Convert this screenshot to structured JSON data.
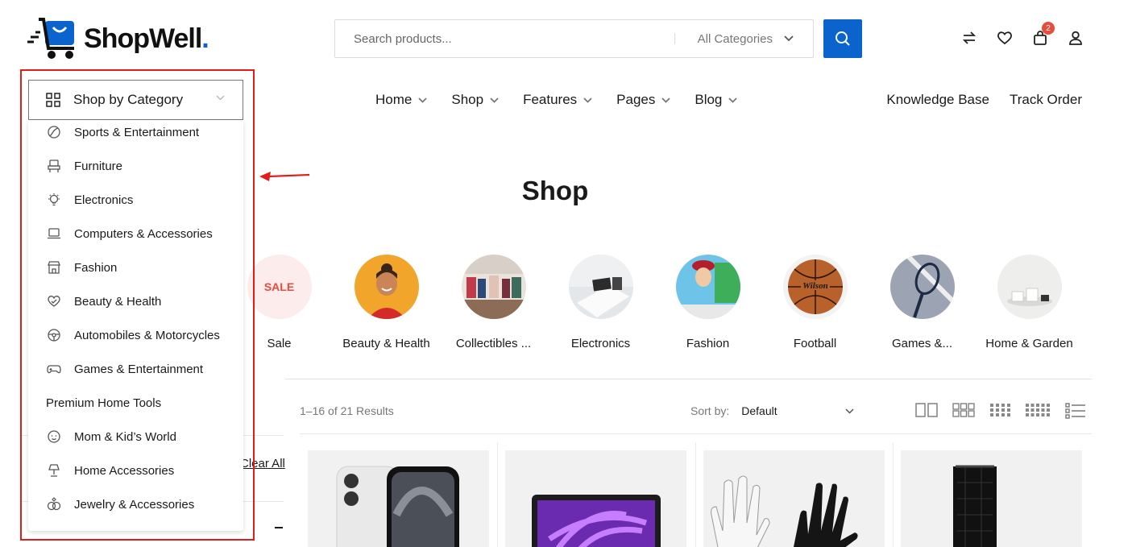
{
  "brand": {
    "name": "ShopWell",
    "dot": ".",
    "accent": "#0b63ce"
  },
  "search": {
    "placeholder": "Search products...",
    "category": "All Categories"
  },
  "header": {
    "cart_count": "2"
  },
  "nav": {
    "items": [
      {
        "label": "Home"
      },
      {
        "label": "Shop"
      },
      {
        "label": "Features"
      },
      {
        "label": "Pages"
      },
      {
        "label": "Blog"
      }
    ],
    "right": [
      {
        "label": "Knowledge Base"
      },
      {
        "label": "Track Order"
      }
    ]
  },
  "category_menu": {
    "toggle_label": "Shop by Category",
    "items": [
      {
        "label": "Sports & Entertainment",
        "icon": "ball-icon"
      },
      {
        "label": "Furniture",
        "icon": "chair-icon"
      },
      {
        "label": "Electronics",
        "icon": "bulb-icon"
      },
      {
        "label": "Computers & Accessories",
        "icon": "laptop-icon"
      },
      {
        "label": "Fashion",
        "icon": "store-icon"
      },
      {
        "label": "Beauty & Health",
        "icon": "heart-icon"
      },
      {
        "label": "Automobiles & Motorcycles",
        "icon": "steering-wheel-icon"
      },
      {
        "label": "Games & Entertainment",
        "icon": "gamepad-icon"
      },
      {
        "label": "Premium Home Tools",
        "icon": ""
      },
      {
        "label": "Mom & Kid’s World",
        "icon": "baby-icon"
      },
      {
        "label": "Home Accessories",
        "icon": "lamp-icon"
      },
      {
        "label": "Jewelry & Accessories",
        "icon": "rings-icon"
      }
    ]
  },
  "page": {
    "title": "Shop"
  },
  "category_circles": [
    {
      "label": "Sale",
      "badge": "SALE"
    },
    {
      "label": "Beauty & Health"
    },
    {
      "label": "Collectibles ..."
    },
    {
      "label": "Electronics"
    },
    {
      "label": "Fashion"
    },
    {
      "label": "Football"
    },
    {
      "label": "Games &..."
    },
    {
      "label": "Home & Garden"
    }
  ],
  "toolbar": {
    "results": "1–16 of 21 Results",
    "sort_label": "Sort by:",
    "sort_value": "Default"
  },
  "sidebar": {
    "clear_all": "Clear All"
  }
}
